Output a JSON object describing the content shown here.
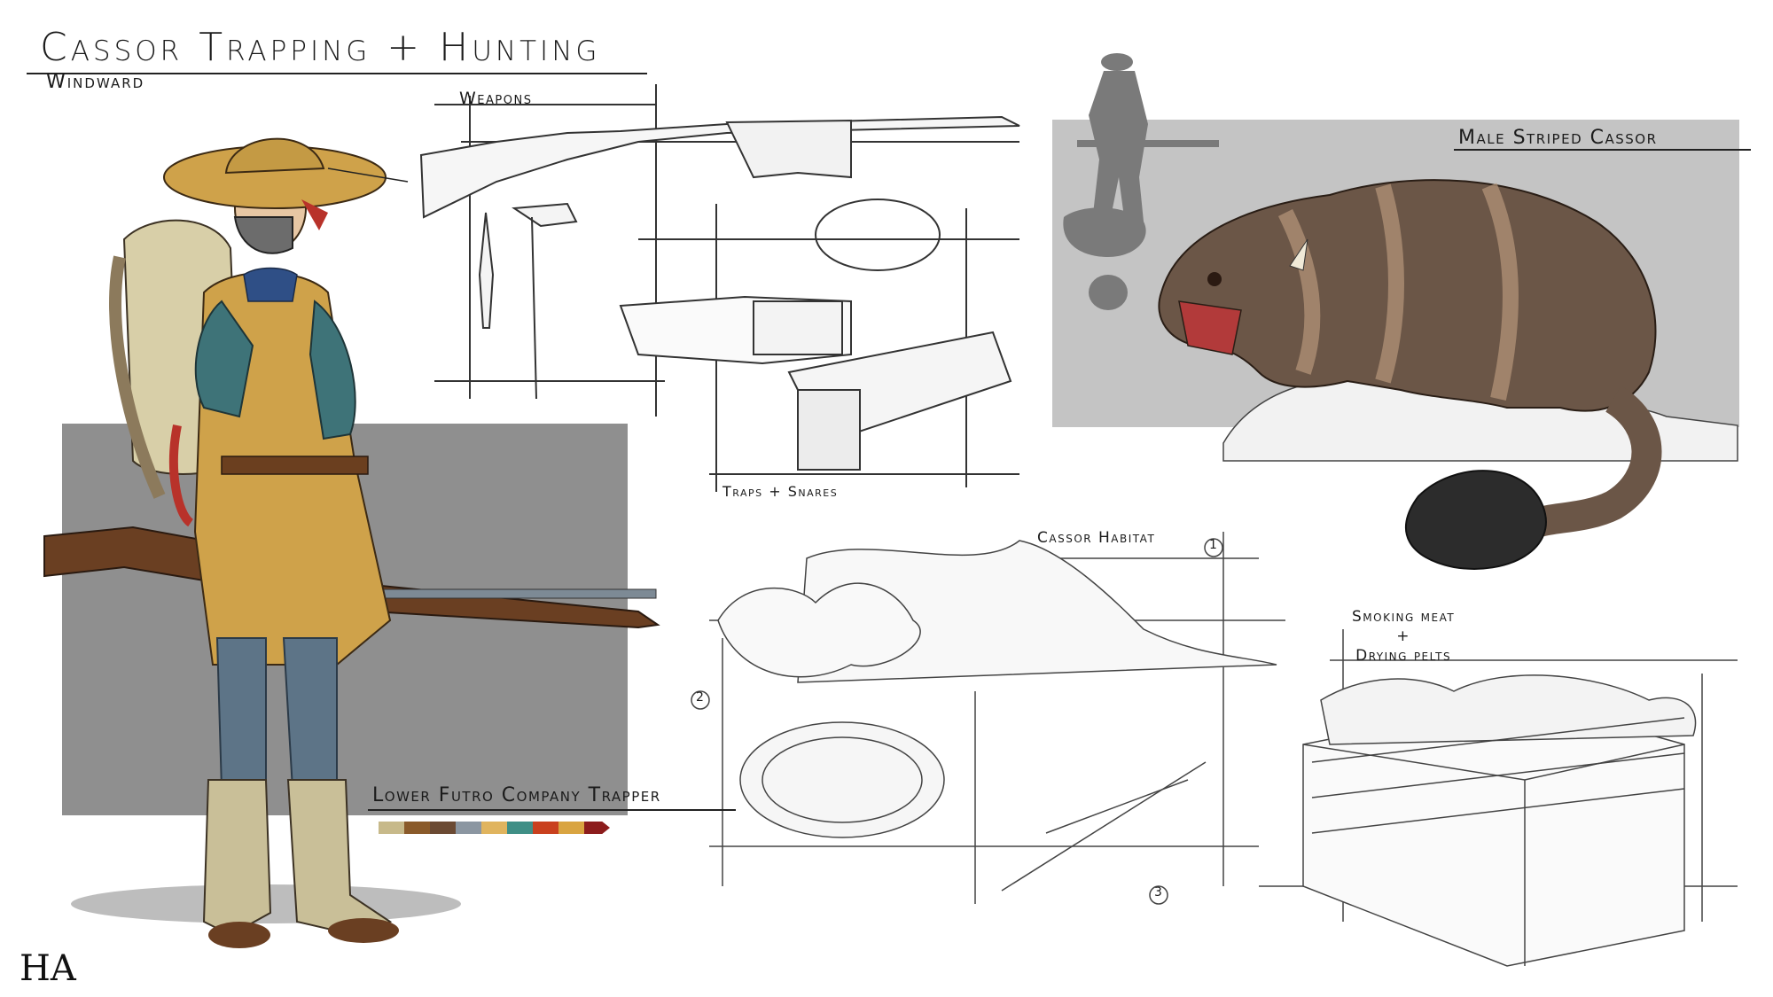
{
  "header": {
    "title": "Cassor Trapping + Hunting",
    "subtitle": "Windward"
  },
  "sections": {
    "weapons": "Weapons",
    "traps": "Traps + Snares",
    "habitat": "Cassor Habitat",
    "smoking_line1": "Smoking meat",
    "smoking_plus": "+",
    "smoking_line2": "Drying pelts",
    "creature": "Male Striped Cassor"
  },
  "character": {
    "caption": "Lower Futro Company Trapper",
    "palette": [
      "#c7b98a",
      "#8a5a2a",
      "#6b4a33",
      "#8b96a1",
      "#e0b45e",
      "#3f8f86",
      "#c9401e",
      "#d9a441",
      "#8c1c1c"
    ]
  },
  "markers": [
    "1",
    "2",
    "3"
  ],
  "signature": "HA"
}
